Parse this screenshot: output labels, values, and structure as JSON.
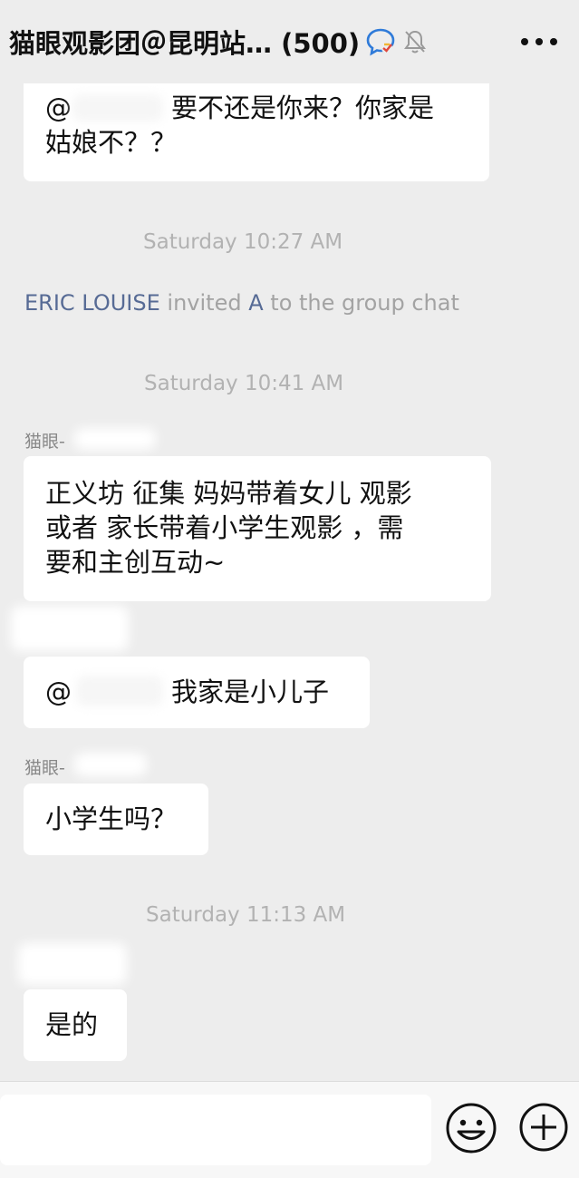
{
  "header": {
    "title": "猫眼观影团＠昆明站… (500)",
    "icons": [
      "chat-bubble-icon",
      "mute-bell-icon",
      "more-icon"
    ]
  },
  "messages": [
    {
      "type": "text",
      "lines": [
        "@",
        "要不还是你来？你家是",
        "姑娘不？？"
      ]
    },
    {
      "type": "time",
      "text": "Saturday 10:27 AM"
    },
    {
      "type": "system",
      "name": "ERIC LOUISE",
      "verb": "invited",
      "invitee": "A",
      "rest": "to the group chat"
    },
    {
      "type": "time",
      "text": "Saturday 10:41 AM"
    },
    {
      "type": "text",
      "sender": "猫眼-",
      "lines": [
        "正义坊 征集  妈妈带着女儿 观影",
        "或者  家长带着小学生观影 ，需",
        "要和主创互动~"
      ]
    },
    {
      "type": "text",
      "lines": [
        "@",
        "我家是小儿子"
      ]
    },
    {
      "type": "text",
      "sender": "猫眼-",
      "lines": [
        "小学生吗？"
      ]
    },
    {
      "type": "time",
      "text": "Saturday 11:13 AM"
    },
    {
      "type": "text",
      "lines": [
        "是的"
      ]
    }
  ],
  "input": {
    "placeholder": ""
  },
  "colors": {
    "background": "#ededed",
    "bubble": "#ffffff",
    "link": "#576b95",
    "time": "#b2b2b2"
  }
}
